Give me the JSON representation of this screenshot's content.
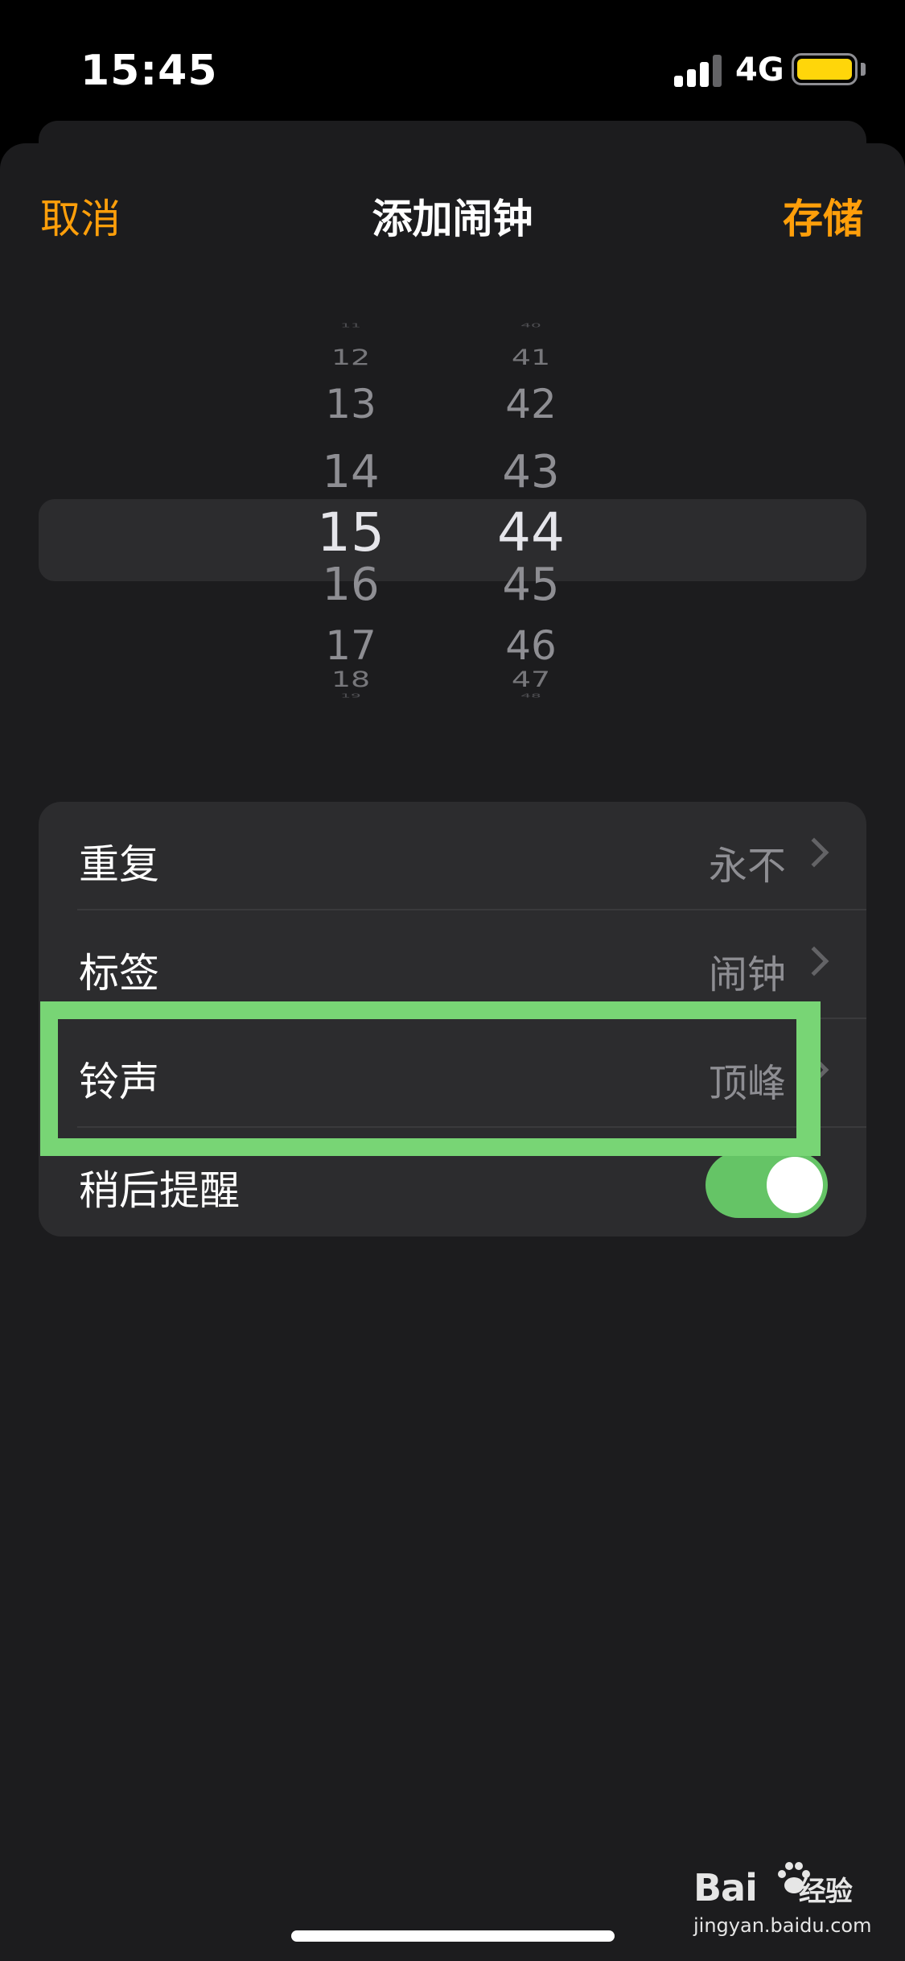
{
  "status_bar": {
    "time": "15:45",
    "network": "4G",
    "battery_color": "#ffd60a",
    "signal_bars": 4
  },
  "nav": {
    "cancel_label": "取消",
    "title": "添加闹钟",
    "save_label": "存储",
    "accent_color": "#ff9f0a"
  },
  "picker": {
    "hours": [
      "11",
      "12",
      "13",
      "14",
      "15",
      "16",
      "17",
      "18",
      "19"
    ],
    "minutes": [
      "40",
      "41",
      "42",
      "43",
      "44",
      "45",
      "46",
      "47",
      "48"
    ],
    "selected_hour": "15",
    "selected_minute": "44"
  },
  "settings": {
    "repeat_label": "重复",
    "repeat_value": "永不",
    "label_label": "标签",
    "label_value": "闹钟",
    "sound_label": "铃声",
    "sound_value": "顶峰",
    "snooze_label": "稍后提醒",
    "snooze_on": true,
    "toggle_color": "#65c466"
  },
  "annotation": {
    "highlight_color": "#78d575",
    "target": "铃声"
  },
  "watermark": {
    "brand": "Bai",
    "brand_suffix": "经验",
    "site": "jingyan.baidu.com"
  }
}
